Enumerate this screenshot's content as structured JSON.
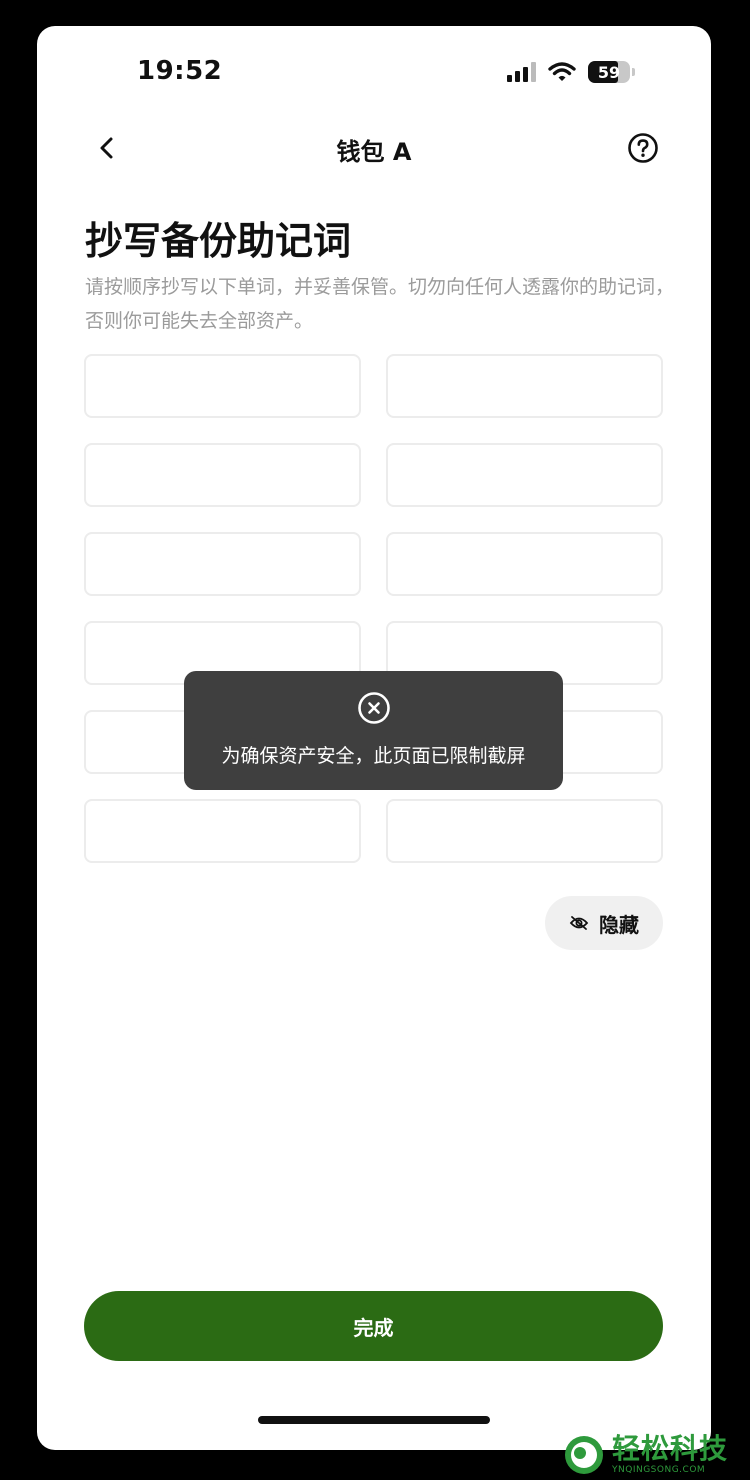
{
  "status_bar": {
    "time": "19:52",
    "battery": "59"
  },
  "nav": {
    "title": "钱包 A"
  },
  "page": {
    "title": "抄写备份助记词",
    "description": "请按顺序抄写以下单词，并妥善保管。切勿向任何人透露你的助记词，否则你可能失去全部资产。"
  },
  "mnemonic_words": [
    "",
    "",
    "",
    "",
    "",
    "",
    "",
    "",
    "",
    "",
    "",
    ""
  ],
  "hide_button": {
    "label": "隐藏"
  },
  "toast": {
    "message": "为确保资产安全，此页面已限制截屏"
  },
  "done_button": {
    "label": "完成"
  },
  "watermark": {
    "title": "轻松科技",
    "subtitle": "YNQINGSONG.COM"
  },
  "colors": {
    "primary": "#2b6b14",
    "toast_bg": "#3f3f3f",
    "muted_text": "#9b9b9b",
    "watermark": "#2e9a3c"
  }
}
